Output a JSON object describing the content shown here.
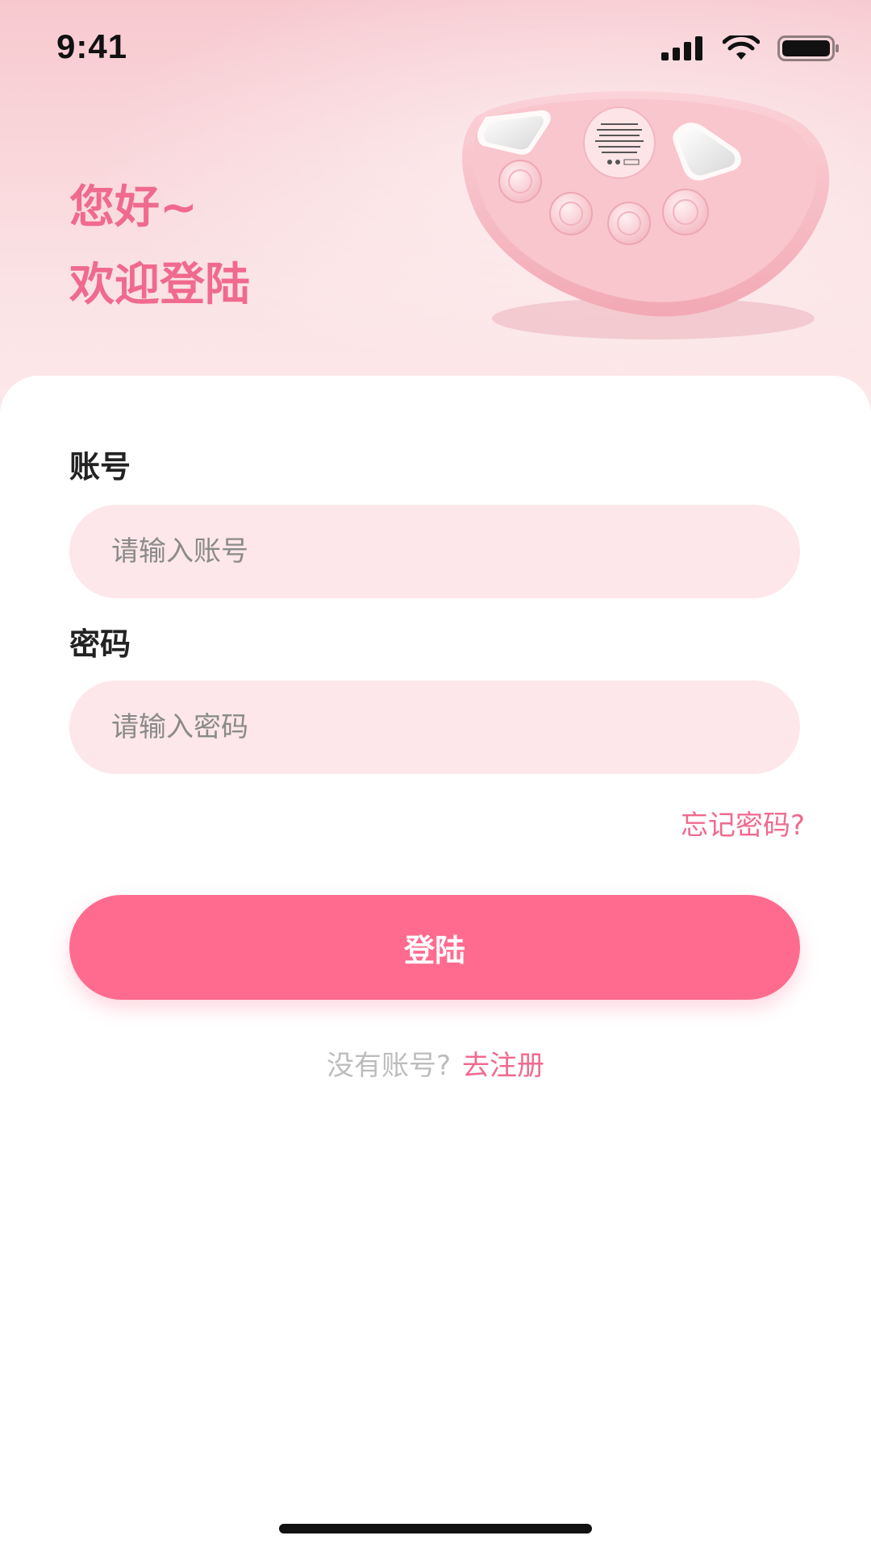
{
  "status_bar": {
    "time": "9:41"
  },
  "header": {
    "greeting_line1": "您好~",
    "greeting_line2": "欢迎登陆"
  },
  "form": {
    "account_label": "账号",
    "account_placeholder": "请输入账号",
    "account_value": "",
    "password_label": "密码",
    "password_placeholder": "请输入密码",
    "password_value": "",
    "forgot_password": "忘记密码?",
    "login_button": "登陆"
  },
  "register": {
    "prompt": "没有账号?",
    "link": "去注册"
  },
  "icons": {
    "signal": "signal-icon",
    "wifi": "wifi-icon",
    "battery": "battery-icon"
  },
  "colors": {
    "accent": "#f06a8e",
    "button": "#ff6b8e",
    "input_bg": "#fde7ea",
    "header_bg": "#f9d6da"
  }
}
